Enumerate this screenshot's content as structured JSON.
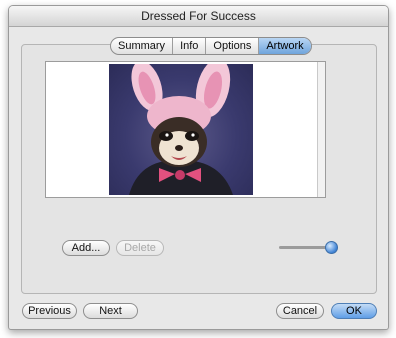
{
  "window": {
    "title": "Dressed For Success"
  },
  "tabs": [
    {
      "label": "Summary",
      "active": false
    },
    {
      "label": "Info",
      "active": false
    },
    {
      "label": "Options",
      "active": false
    },
    {
      "label": "Artwork",
      "active": true
    }
  ],
  "artwork": {
    "add_label": "Add...",
    "delete_label": "Delete",
    "delete_enabled": false,
    "size_slider_value": 1.0
  },
  "footer": {
    "previous_label": "Previous",
    "next_label": "Next",
    "cancel_label": "Cancel",
    "ok_label": "OK"
  },
  "colors": {
    "accent": "#5f9ee6",
    "tab_active": "#6fa4dc"
  }
}
